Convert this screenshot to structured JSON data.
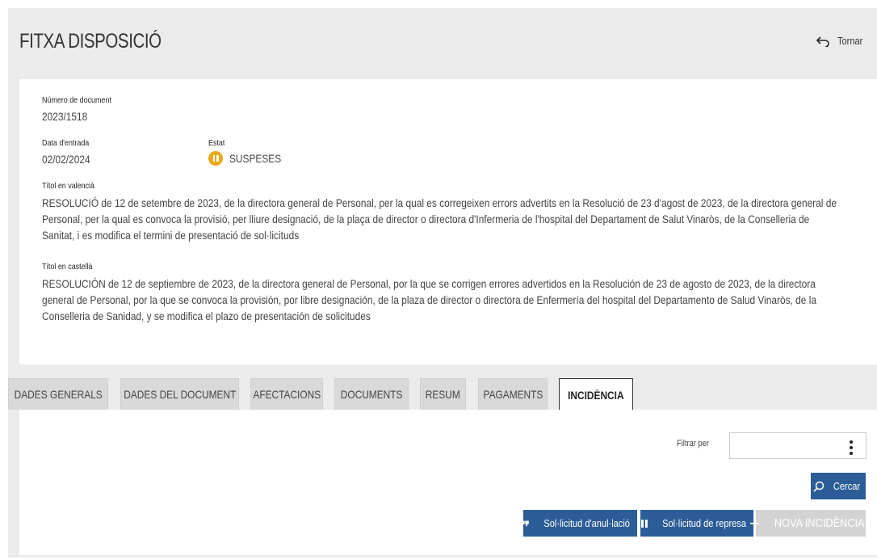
{
  "header": {
    "title": "FITXA DISPOSICIÓ",
    "back_label": "Tornar"
  },
  "document": {
    "number_label": "Número de document",
    "number_value": "2023/1518",
    "entry_date_label": "Data d'entrada",
    "entry_date_value": "02/02/2024",
    "status_label": "Estat",
    "status_value": "SUSPESES",
    "status_color": "#e8a817",
    "title_va_label": "Títol en valencià",
    "title_va_value": "RESOLUCIÓ de 12 de setembre de 2023, de la directora general de Personal, per la qual es corregeixen errors advertits en la Resolució de 23 d'agost de 2023, de la directora general de Personal, per la qual es convoca la provisió, per lliure designació, de la plaça de director o directora d'Infermeria de l'hospital del Departament de Salut Vinaròs, de la Conselleria de Sanitat, i es modifica el termini de presentació de sol·licituds",
    "title_es_label": "Títol en castellà",
    "title_es_value": "RESOLUCIÓN de 12 de septiembre de 2023, de la directora general de Personal, por la que se corrigen errores advertidos en la Resolución de 23 de agosto de 2023, de la directora general de Personal, por la que se convoca la provisión, por libre designación, de la plaza de director o directora de Enfermería del hospital del Departamento de Salud Vinaròs, de la Conselleria de Sanidad, y se modifica el plazo de presentación de solicitudes"
  },
  "tabs": [
    {
      "label": "DADES GENERALS",
      "active": false
    },
    {
      "label": "DADES DEL DOCUMENT",
      "active": false
    },
    {
      "label": "AFECTACIONS",
      "active": false
    },
    {
      "label": "DOCUMENTS",
      "active": false
    },
    {
      "label": "RESUM",
      "active": false
    },
    {
      "label": "PAGAMENTS",
      "active": false
    },
    {
      "label": "INCIDÈNCIA",
      "active": true
    }
  ],
  "incidence_panel": {
    "filter_label": "Filtrar per",
    "search_label": "Cercar",
    "annul_request_label": "Sol·licitud d'anul·lació",
    "resume_request_label": "Sol·licitud de represa",
    "new_incidence_label": "NOVA INCIDÈNCIA"
  },
  "colors": {
    "primary_button": "#2c5d98",
    "disabled_button": "#d3d3d3",
    "page_background": "#ebebeb"
  }
}
